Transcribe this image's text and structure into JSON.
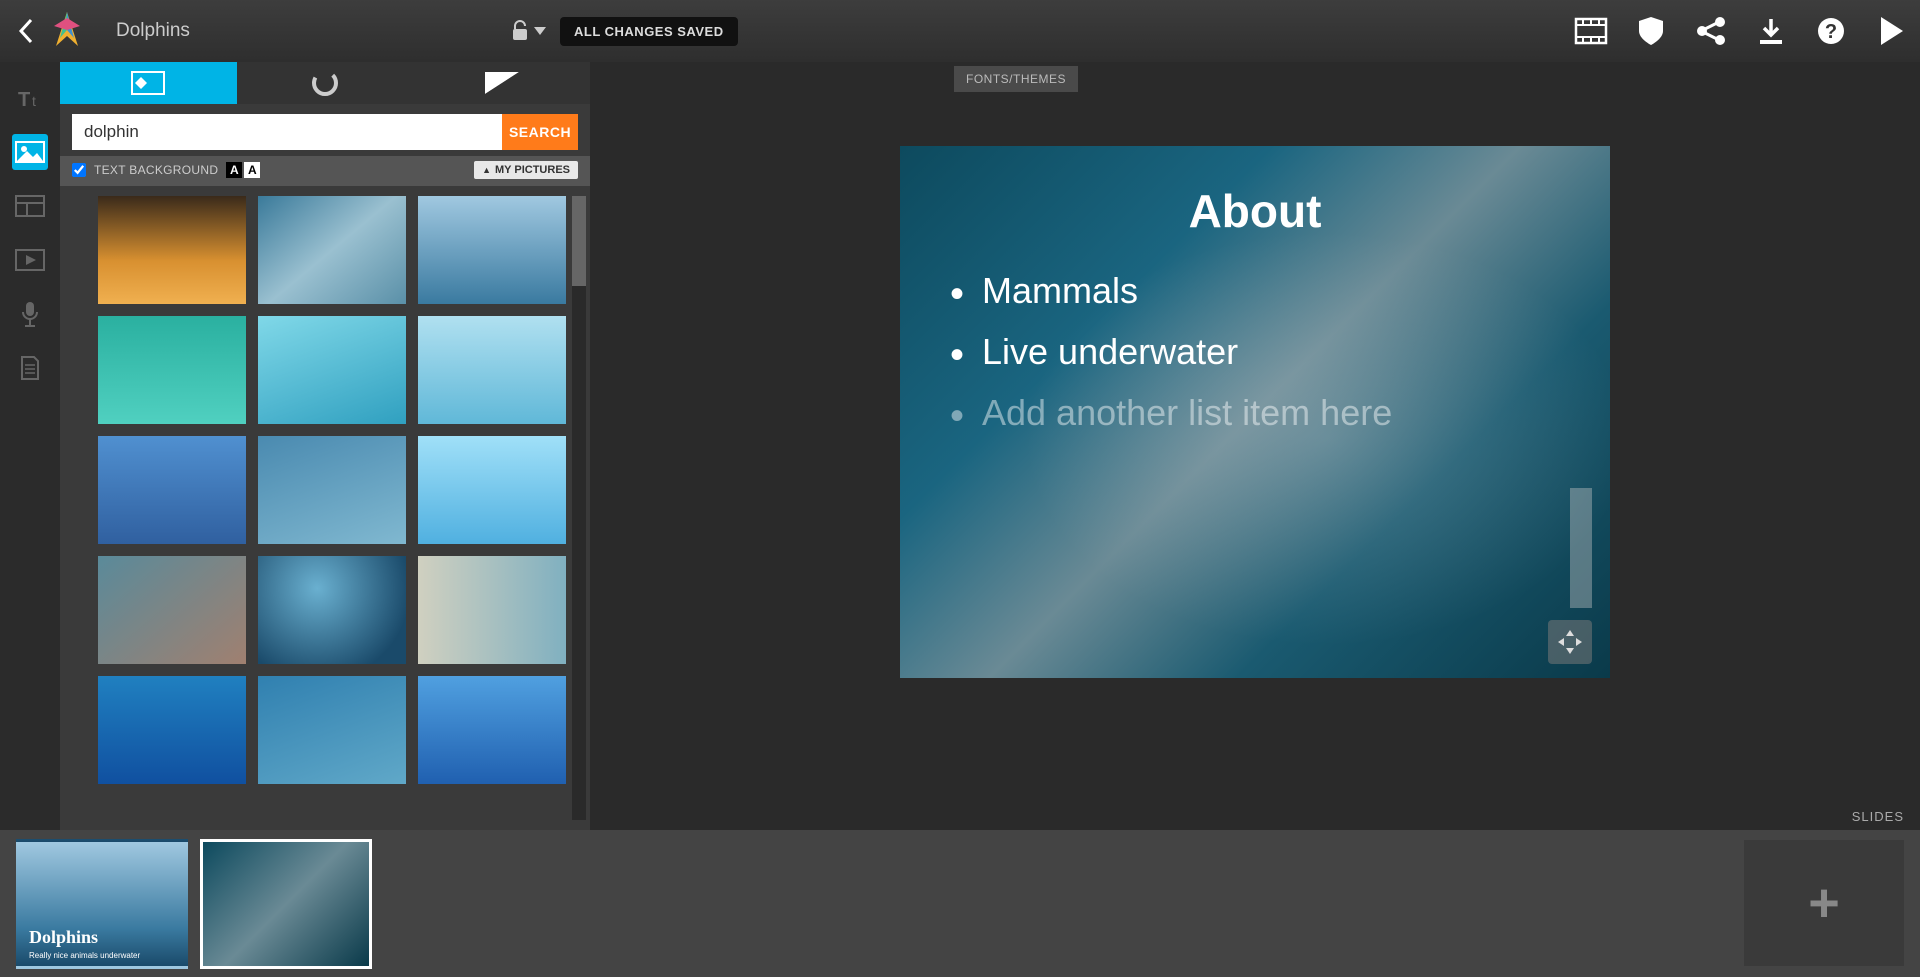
{
  "header": {
    "title": "Dolphins",
    "saved_badge": "ALL CHANGES SAVED"
  },
  "panel": {
    "search_value": "dolphin",
    "search_button": "SEARCH",
    "text_background_label": "TEXT BACKGROUND",
    "my_pictures_label": "MY PICTURES"
  },
  "canvas": {
    "fonts_themes_label": "FONTS/THEMES",
    "slides_label": "SLIDES",
    "slide": {
      "title": "About",
      "bullets": [
        "Mammals",
        "Live underwater"
      ],
      "placeholder": "Add another list item here"
    }
  },
  "thumbs": {
    "slide1": {
      "title": "Dolphins",
      "sub": "Really nice animals underwater"
    }
  },
  "icons": {
    "rail": [
      "text-icon",
      "image-icon",
      "layout-icon",
      "video-icon",
      "mic-icon",
      "doc-icon"
    ],
    "topright": [
      "film-icon",
      "shield-icon",
      "share-icon",
      "download-icon",
      "help-icon",
      "play-icon"
    ]
  }
}
